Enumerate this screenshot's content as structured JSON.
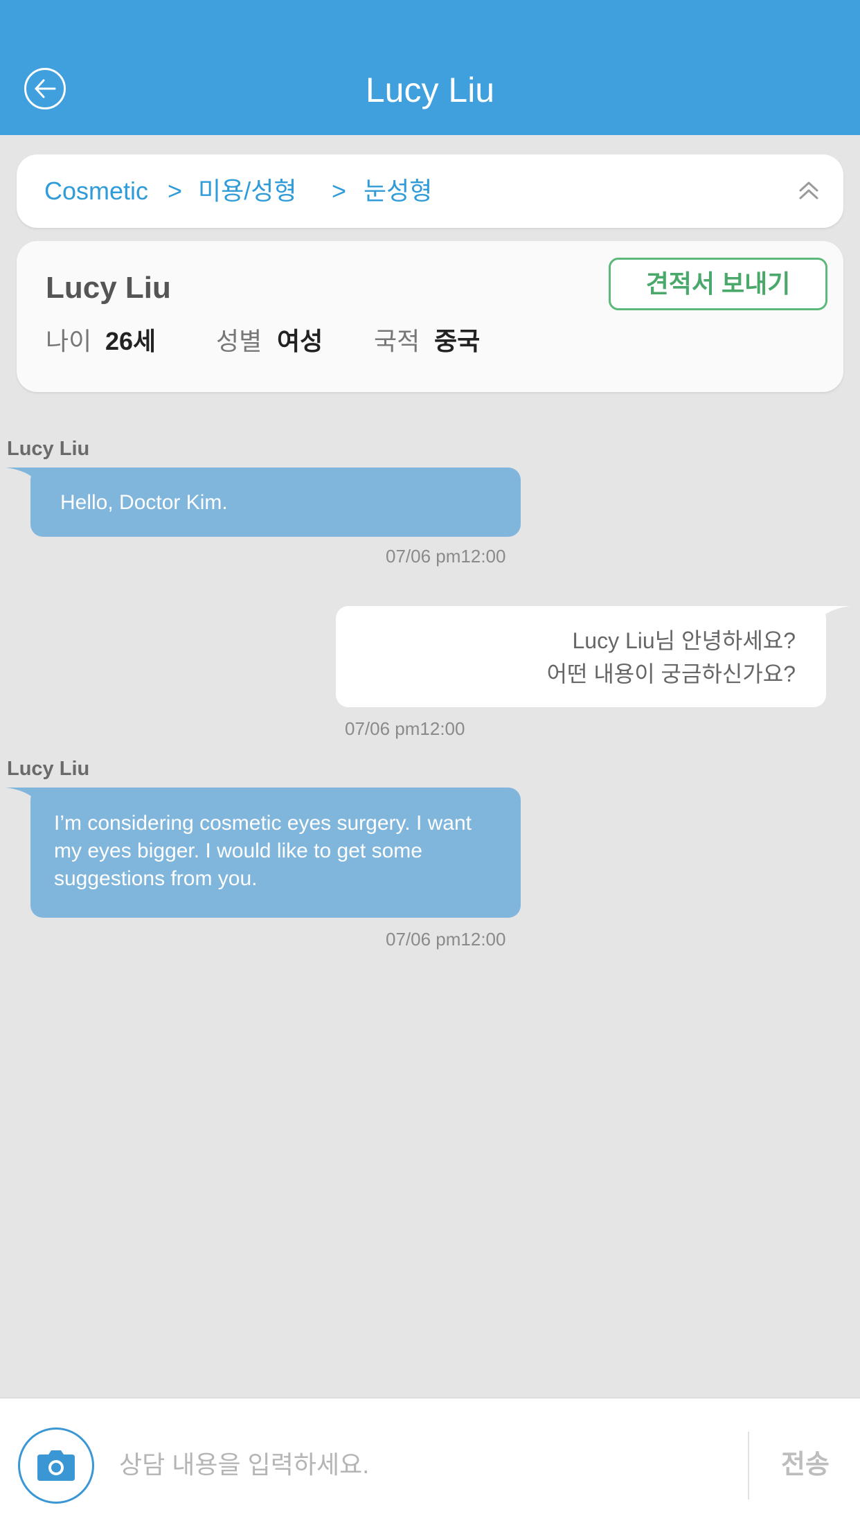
{
  "header": {
    "title": "Lucy Liu",
    "back_icon": "arrow-left-circle-icon"
  },
  "breadcrumb": {
    "items": [
      "Cosmetic",
      "미용/성형",
      "눈성형"
    ],
    "separator": ">",
    "collapse_icon": "chevron-double-up-icon"
  },
  "profile": {
    "name": "Lucy Liu",
    "quote_button": "견적서 보내기",
    "age_label": "나이",
    "age_value": "26세",
    "gender_label": "성별",
    "gender_value": "여성",
    "nationality_label": "국적",
    "nationality_value": "중국"
  },
  "messages": [
    {
      "direction": "incoming",
      "sender": "Lucy Liu",
      "text": "Hello, Doctor Kim.",
      "time": "07/06  pm12:00"
    },
    {
      "direction": "outgoing",
      "lines": [
        "Lucy Liu님 안녕하세요?",
        "어떤 내용이 궁금하신가요?"
      ],
      "time": "07/06  pm12:00"
    },
    {
      "direction": "incoming",
      "sender": "Lucy Liu",
      "lines": [
        "I’m considering cosmetic eyes surgery. I want",
        "my eyes bigger. I would like to get some",
        "suggestions from you."
      ],
      "time": "07/06  pm12:00"
    }
  ],
  "composer": {
    "camera_icon": "camera-icon",
    "placeholder": "상담 내용을 입력하세요.",
    "send_label": "전송"
  },
  "colors": {
    "header": "#3fa0dd",
    "background": "#e5e5e5",
    "incoming_bubble": "#80b6dc",
    "outgoing_bubble": "#ffffff",
    "quote_button": "#5cb87b",
    "link": "#2f9bd8"
  }
}
